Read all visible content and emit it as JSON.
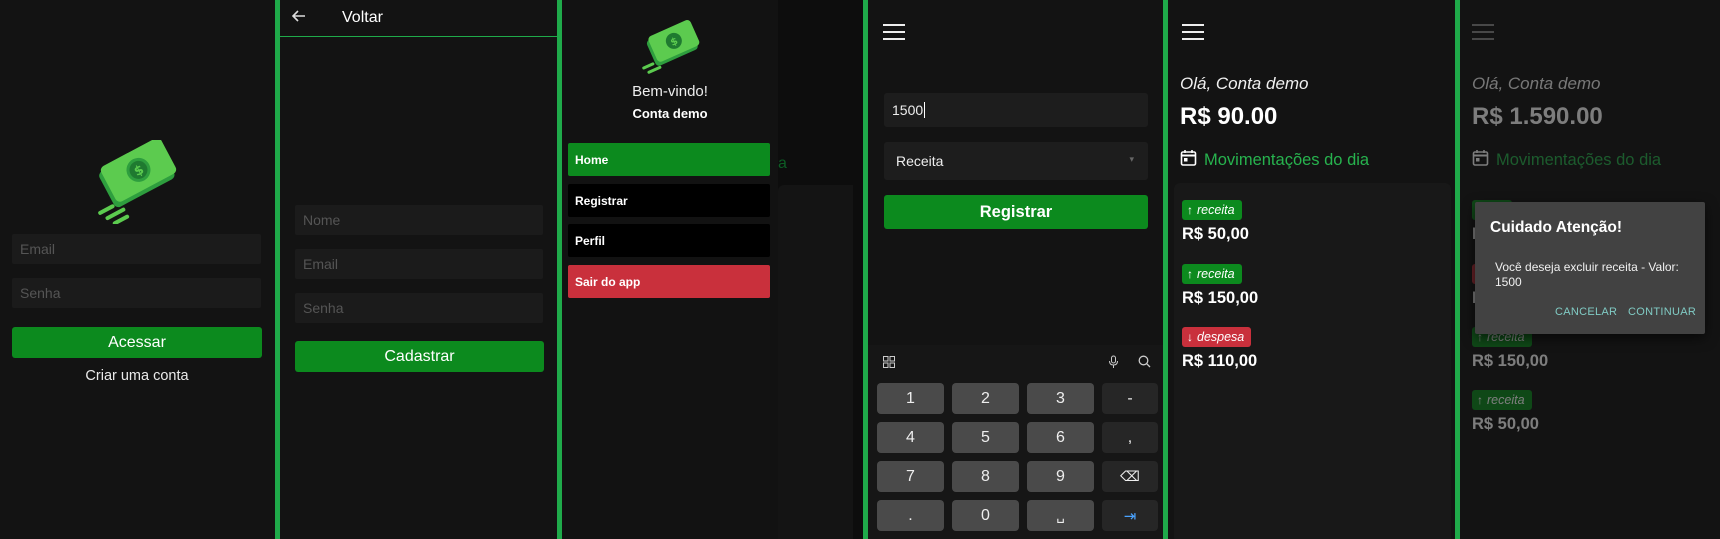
{
  "colors": {
    "accent": "#1faa4a",
    "button_green": "#0c8a1e",
    "danger": "#c9303c",
    "background": "#121212"
  },
  "login": {
    "email_placeholder": "Email",
    "password_placeholder": "Senha",
    "login_button": "Acessar",
    "create_account_link": "Criar uma conta"
  },
  "signup": {
    "back_icon": "arrow-left-icon",
    "back_label": "Voltar",
    "name_placeholder": "Nome",
    "email_placeholder": "Email",
    "password_placeholder": "Senha",
    "submit_button": "Cadastrar"
  },
  "drawer": {
    "welcome": "Bem-vindo!",
    "account_name": "Conta demo",
    "peek_text": "a",
    "items": [
      {
        "label": "Home",
        "active": true
      },
      {
        "label": "Registrar"
      },
      {
        "label": "Perfil"
      },
      {
        "label": "Sair do app",
        "danger": true
      }
    ]
  },
  "register": {
    "amount_value": "1500",
    "type_selected": "Receita",
    "submit_button": "Registrar",
    "keyboard": {
      "rows": [
        [
          "1",
          "2",
          "3",
          "-"
        ],
        [
          "4",
          "5",
          "6",
          ","
        ],
        [
          "7",
          "8",
          "9",
          "⌫"
        ],
        [
          ".",
          "0",
          "␣",
          "⇥"
        ]
      ]
    }
  },
  "home": {
    "greeting": "Olá, Conta demo",
    "balance": "R$ 90.00",
    "section_title": "Movimentações do dia",
    "transactions": [
      {
        "type": "receita",
        "amount": "R$ 50,00"
      },
      {
        "type": "receita",
        "amount": "R$ 150,00"
      },
      {
        "type": "despesa",
        "amount": "R$ 110,00"
      }
    ]
  },
  "dialog_screen": {
    "greeting": "Olá, Conta demo",
    "balance": "R$ 1.590.00",
    "section_title": "Movimentações do dia",
    "transactions": [
      {
        "type": "receita",
        "amount": "R$ 150,00"
      },
      {
        "type": "receita",
        "amount": "R$ 50,00"
      }
    ],
    "dialog": {
      "title": "Cuidado Atenção!",
      "message": "Você deseja excluir receita - Valor: 1500",
      "cancel": "CANCELAR",
      "confirm": "CONTINUAR"
    }
  }
}
